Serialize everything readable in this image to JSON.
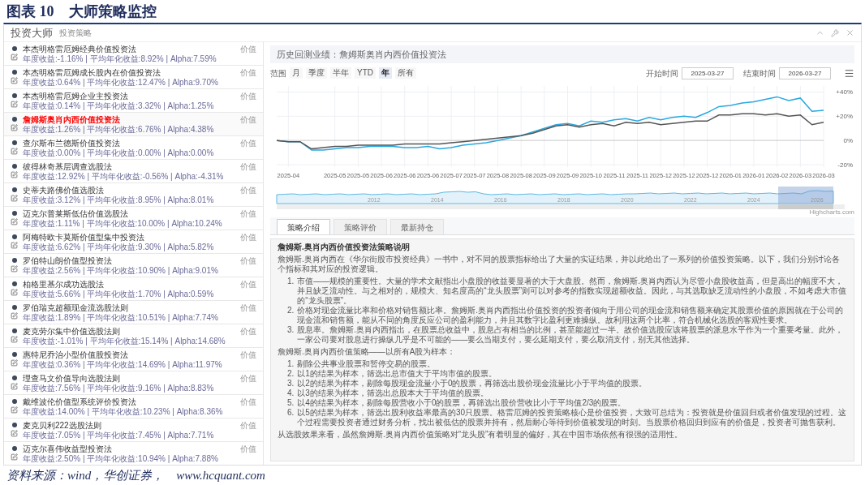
{
  "figure_title": "图表 10　大师策略监控",
  "window": {
    "title": "投资大师",
    "subtitle": "投资策略"
  },
  "strategies": [
    {
      "name": "本杰明格雷厄姆经典价值投资法",
      "stats": "年度收益:-1.16% | 平均年化收益:8.92% | Alpha:7.59%",
      "tag": "价值",
      "selected": false
    },
    {
      "name": "本杰明格雷厄姆成长股内在价值投资法",
      "stats": "年度收益:0.64% | 平均年化收益:12.47% | Alpha:9.70%",
      "tag": "价值",
      "selected": false
    },
    {
      "name": "本杰明格雷厄姆企业主投资法",
      "stats": "年度收益:0.14% | 平均年化收益:3.32% | Alpha:1.25%",
      "tag": "价值",
      "selected": false
    },
    {
      "name": "詹姆斯奥肖内西价值投资法",
      "stats": "年度收益:1.26% | 平均年化收益:6.76% | Alpha:4.38%",
      "tag": "价值",
      "selected": true
    },
    {
      "name": "查尔斯布兰德斯价值投资法",
      "stats": "年度收益:0.00% | 平均年化收益:0.00% | Alpha:0.00%",
      "tag": "价值",
      "selected": false
    },
    {
      "name": "彼得林奇基层调查选股法",
      "stats": "年度收益:12.92% | 平均年化收益:-0.56% | Alpha:-4.31%",
      "tag": "价值",
      "selected": false
    },
    {
      "name": "史蒂夫路佛价值选股法",
      "stats": "年度收益:3.12% | 平均年化收益:8.95% | Alpha:8.01%",
      "tag": "价值",
      "selected": false
    },
    {
      "name": "迈克尔普莱斯低估价值选股法",
      "stats": "年度收益:1.11% | 平均年化收益:10.00% | Alpha:10.24%",
      "tag": "价值",
      "selected": false
    },
    {
      "name": "阿梅特欧卡莫斯价值型集中投资法",
      "stats": "年度收益:6.62% | 平均年化收益:9.30% | Alpha:5.82%",
      "tag": "价值",
      "selected": false
    },
    {
      "name": "罗伯特山朗价值型投资法",
      "stats": "年度收益:2.56% | 平均年化收益:10.90% | Alpha:9.01%",
      "tag": "价值",
      "selected": false
    },
    {
      "name": "柏格里基尔成功选股法",
      "stats": "年度收益:5.66% | 平均年化收益:1.70% | Alpha:0.59%",
      "tag": "价值",
      "selected": false
    },
    {
      "name": "罗伯瑞克超额现金流选股法则",
      "stats": "年度收益:1.89% | 平均年化收益:10.51% | Alpha:7.74%",
      "tag": "价值",
      "selected": false
    },
    {
      "name": "麦克劳尔集中价值选股法则",
      "stats": "年度收益:-1.01% | 平均年化收益:15.14% | Alpha:14.68%",
      "tag": "价值",
      "selected": false
    },
    {
      "name": "惠特尼乔治小型价值股投资法",
      "stats": "年度收益:0.36% | 平均年化收益:14.69% | Alpha:11.97%",
      "tag": "价值",
      "selected": false
    },
    {
      "name": "理查马文价值导向选股法则",
      "stats": "年度收益:7.56% | 平均年化收益:9.16% | Alpha:8.83%",
      "tag": "价值",
      "selected": false
    },
    {
      "name": "戴维波伦价值型系统评价投资法",
      "stats": "年度收益:14.00% | 平均年化收益:10.23% | Alpha:8.36%",
      "tag": "价值",
      "selected": false
    },
    {
      "name": "麦克贝利222选股法则",
      "stats": "年度收益:7.05% | 平均年化收益:7.45% | Alpha:7.71%",
      "tag": "价值",
      "selected": false
    },
    {
      "name": "迈克尔喜伟收益型投资法",
      "stats": "年度收益:2.50% | 平均年化收益:10.94% | Alpha:7.88%",
      "tag": "价值",
      "selected": false
    }
  ],
  "backtest": {
    "title": "历史回测业绩：詹姆斯奥肖内西价值投资法",
    "range_label": "范围",
    "ranges": [
      {
        "label": "月",
        "selected": false
      },
      {
        "label": "季度",
        "selected": false
      },
      {
        "label": "半年",
        "selected": false
      },
      {
        "label": "YTD",
        "selected": false
      },
      {
        "label": "年",
        "selected": true
      },
      {
        "label": "所有",
        "selected": false
      }
    ],
    "start_label": "开始时间",
    "start_value": "2025-03-27",
    "end_label": "结束时间",
    "end_value": "2026-03-27",
    "chart_data": {
      "type": "line",
      "grid": true,
      "categories": [
        null,
        "2025-04",
        null,
        null,
        null,
        "2025-05",
        null,
        "2025-05",
        null,
        "2025-06",
        null,
        "2025-06",
        null,
        "2025-06",
        null,
        "2025-07",
        null,
        "2025-07",
        null,
        "2025-08",
        null,
        "2025-08",
        null,
        "2025-09",
        null,
        "2025-09",
        null,
        "2025-10",
        null,
        "2025-11",
        null,
        "2025-11",
        null,
        "2025-12",
        null,
        "2025-12",
        null,
        "2025-12",
        null,
        "2026-01",
        null,
        "2026-01",
        null,
        "2026-02",
        null,
        "2026-03",
        null,
        "2026-03"
      ],
      "series": [
        {
          "color": "#29a8e0",
          "values": [
            0,
            -1,
            -1,
            -8,
            -8,
            -7,
            -6,
            -6,
            -5,
            -5,
            -5,
            -6,
            -6,
            -5,
            -7,
            -6,
            -4,
            -3,
            -2,
            0,
            2,
            4,
            7,
            10,
            13,
            14,
            12,
            16,
            15,
            17,
            18,
            16,
            19,
            17,
            19,
            20,
            19,
            23,
            28,
            29,
            31,
            32,
            34,
            36,
            33,
            35,
            24,
            25
          ]
        },
        {
          "color": "#555555",
          "values": [
            0,
            -1,
            -1,
            -7,
            -6,
            -5,
            -5,
            -4,
            -4,
            -4,
            -4,
            -3,
            -3,
            -3,
            -3,
            -2,
            -1,
            0,
            1,
            2,
            3,
            4,
            6,
            9,
            12,
            13,
            11,
            13,
            14,
            12,
            15,
            14,
            15,
            13,
            14,
            15,
            16,
            16,
            21,
            21,
            22,
            22,
            21,
            22,
            20,
            21,
            13,
            15
          ]
        }
      ],
      "ylim": [
        -22,
        45
      ],
      "yticks": [
        {
          "value": 40,
          "label": "+40%"
        },
        {
          "value": 20,
          "label": "+20%"
        },
        {
          "value": 0,
          "label": "0%"
        },
        {
          "value": -20,
          "label": "-20%"
        }
      ]
    },
    "navigator_labels": [
      "2012",
      "2014",
      "2016",
      "2018",
      "2020",
      "2022",
      "2024",
      "2026"
    ],
    "credit": "Highcharts.com"
  },
  "tabs": [
    {
      "label": "策略介绍",
      "selected": true
    },
    {
      "label": "策略评价",
      "selected": false
    },
    {
      "label": "最新持仓",
      "selected": false
    }
  ],
  "description": {
    "title": "詹姆斯.奥肖内西价值投资法策略说明",
    "intro": "詹姆斯.奥肖内西在《华尔街股市投资经典》一书中，对不同的股票指标给出了大量的实证结果，并以此给出了一系列的价值投资策略。以下，我们分别讨论各个指标和其对应的投资逻辑。",
    "factors": [
      {
        "num": "1.",
        "text": "市值——规模的重要性。大量的学术文献指出小盘股的收益要显著的大于大盘股。然而，詹姆斯.奥肖内西认为尽管小盘股收益高，但是高出的幅度不大，并且缺乏流动性。与之相对的，规模大、知名度高的“龙头股票”则可以对参考的指数实现超额收益。因此，与其选取缺乏流动性的小盘股，不如考虑大市值的“龙头股票”。"
      },
      {
        "num": "2.",
        "text": "价格对现金流量比率和价格对销售额比率。詹姆斯.奥肖内西指出价值投资的投资者倾向于用公司的现金流和销售额来确定其股票价值的原因就在于公司的现金流和销售额，能从不同的角度反应公司的盈利能力，并且其数字比盈利更难操纵。故利用这两个比率，符合机械化选股的客观性要求。"
      },
      {
        "num": "3.",
        "text": "股息率。詹姆斯.奥肖内西指出，在股票总收益中，股息占有相当的比例，甚至能超过一半。故价值选股应该将股票的派息水平作为一个重要考量。此外，一家公司要对股息进行操纵几乎是不可能的——要么当期支付，要么延期支付，要么取消支付，别无其他选择。"
      }
    ],
    "steps_title": "詹姆斯.奥肖内西价值策略——以所有A股为样本：",
    "steps": [
      {
        "num": "1.",
        "text": "剔除公共事业股票和暂停交易的股票。"
      },
      {
        "num": "2.",
        "text": "以1的结果为样本，筛选出总市值大于平均市值的股票。"
      },
      {
        "num": "3.",
        "text": "以2的结果为样本，剔除每股现金流量小于0的股票，再筛选出股价现金流量比小于平均值的股票。"
      },
      {
        "num": "4.",
        "text": "以3的结果为样本，筛选出总股本大于平均值的股票。"
      },
      {
        "num": "5.",
        "text": "以4的结果为样本，剔除每股营收小于0的股票，再筛选出股价营收比小于平均值2/3的股票。"
      },
      {
        "num": "6.",
        "text": "以5的结果为样本，筛选出股利收益率最高的30只股票。格雷厄姆的投资策略核心是价值投资，大致可总结为：投资就是价值回归或者价值发现的过程。这个过程需要投资者通过财务分析，找出被低估的股票并持有，然后耐心等待到价值被发现的时刻。当股票价格回归到应有的价值是，投资者可抛售获利。"
      }
    ],
    "conclusion": "从选股效果来看，虽然詹姆斯.奥肖内西价值策略对“龙头股”有着明显的偏好，其在中国市场依然有很强的适用性。"
  },
  "source": "资料来源：wind，华创证券，　www.hcquant.com"
}
